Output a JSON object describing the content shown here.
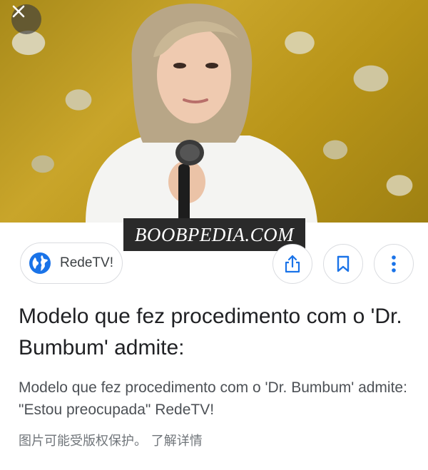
{
  "image": {
    "alt_description": ""
  },
  "watermark": {
    "text": "BOOBPEDIA.COM"
  },
  "source": {
    "name": "RedeTV!"
  },
  "actions": {
    "share": "share-icon",
    "bookmark": "bookmark-icon",
    "more": "more-vert-icon"
  },
  "result": {
    "title": "Modelo que fez procedimento com o 'Dr. Bumbum' admite:",
    "description": "Modelo que fez procedimento com o 'Dr. Bumbum' admite: \"Estou preocupada\" RedeTV!",
    "copyright_notice": "图片可能受版权保护。 了解详情"
  },
  "colors": {
    "accent_blue": "#1a73e8",
    "chip_border": "#dadce0",
    "watermark_bg": "#2a2a2a"
  }
}
